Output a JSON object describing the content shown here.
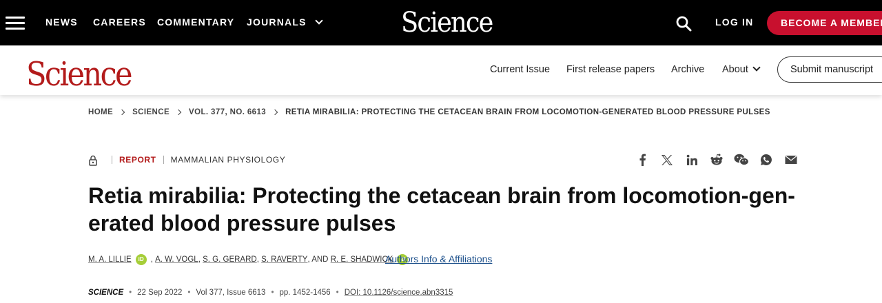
{
  "topbar": {
    "nav": [
      "NEWS",
      "CAREERS",
      "COMMENTARY",
      "JOURNALS"
    ],
    "logo_text": "Science",
    "login_label": "LOG IN",
    "member_label": "BECOME A MEMBER",
    "icons": [
      "menu-icon",
      "chevron-down-icon",
      "search-icon"
    ]
  },
  "subbar": {
    "logo_text": "Science",
    "nav": [
      "Current Issue",
      "First release papers",
      "Archive",
      "About"
    ],
    "submit_label": "Submit manuscript"
  },
  "breadcrumb": [
    "HOME",
    "SCIENCE",
    "VOL. 377, NO. 6613",
    "RETIA MIRABILIA: PROTECTING THE CETACEAN BRAIN FROM LOCOMOTION-GENERATED BLOOD PRESSURE PULSES"
  ],
  "article": {
    "type": "REPORT",
    "subject": "MAMMALIAN PHYSIOLOGY",
    "title": "Retia mirabilia: Protecting the cetacean brain from locomotion-gen- erated blood pressure pulses",
    "authors": [
      "M. A. LILLIE",
      "A. W. VOGL",
      "S. G. GERARD",
      "S. RAVERTY",
      "R. E. SHADWICK"
    ],
    "separators": [
      ",",
      ",",
      ",",
      ", AND"
    ],
    "orcid_label": "iD",
    "affiliations_label": "Authors Info & Affiliations",
    "citation": {
      "journal": "SCIENCE",
      "date": "22 Sep 2022",
      "volume": "Vol 377, Issue 6613",
      "pages": "pp. 1452-1456",
      "doi": "DOI: 10.1126/science.abn3315"
    }
  },
  "share_icons": [
    "facebook-icon",
    "x-icon",
    "linkedin-icon",
    "reddit-icon",
    "wechat-icon",
    "whatsapp-icon",
    "email-icon"
  ],
  "colors": {
    "topbar_bg": "#000000",
    "accent_red": "#c8102e",
    "logo_red": "#b31b1b",
    "link_blue": "#1a4e8a",
    "orcid_green": "#a6ce39"
  }
}
